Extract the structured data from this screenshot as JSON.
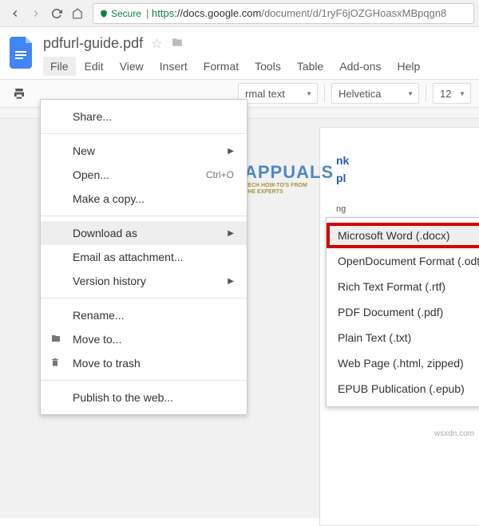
{
  "browser": {
    "secure_label": "Secure",
    "url_scheme": "https",
    "url_host": "://docs.google.com",
    "url_path": "/document/d/1ryF6jOZGHoasxMBpqgn8"
  },
  "doc": {
    "title": "pdfurl-guide.pdf"
  },
  "menubar": {
    "file": "File",
    "edit": "Edit",
    "view": "View",
    "insert": "Insert",
    "format": "Format",
    "tools": "Tools",
    "table": "Table",
    "addons": "Add-ons",
    "help": "Help"
  },
  "toolbar": {
    "style_label_fragment": "rmal text",
    "font": "Helvetica",
    "font_size": "12"
  },
  "file_menu": {
    "share": "Share...",
    "new": "New",
    "open": "Open...",
    "open_shortcut": "Ctrl+O",
    "make_copy": "Make a copy...",
    "download_as": "Download as",
    "email_attachment": "Email as attachment...",
    "version_history": "Version history",
    "rename": "Rename...",
    "move_to": "Move to...",
    "move_to_trash": "Move to trash",
    "publish": "Publish to the web..."
  },
  "download_submenu": {
    "docx": "Microsoft Word (.docx)",
    "odt": "OpenDocument Format (.odt)",
    "rtf": "Rich Text Format (.rtf)",
    "pdf": "PDF Document (.pdf)",
    "txt": "Plain Text (.txt)",
    "html": "Web Page (.html, zipped)",
    "epub": "EPUB Publication (.epub)"
  },
  "watermark": {
    "title": "APPUALS",
    "sub1": "TECH HOW-TO'S FROM",
    "sub2": "THE EXPERTS"
  },
  "attribution": "wsxdn.com"
}
